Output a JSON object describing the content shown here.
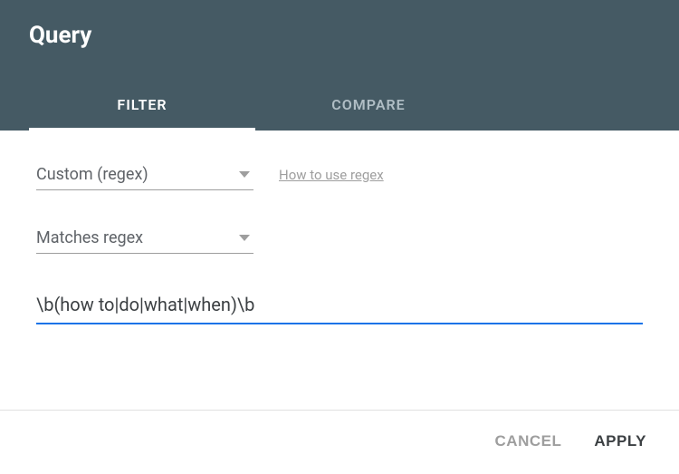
{
  "header": {
    "title": "Query"
  },
  "tabs": {
    "filter": "FILTER",
    "compare": "COMPARE"
  },
  "filterType": {
    "selected": "Custom (regex)"
  },
  "helpLink": "How to use regex",
  "matchMode": {
    "selected": "Matches regex"
  },
  "regexInput": {
    "value": "\\b(how to|do|what|when)\\b"
  },
  "footer": {
    "cancel": "CANCEL",
    "apply": "APPLY"
  }
}
